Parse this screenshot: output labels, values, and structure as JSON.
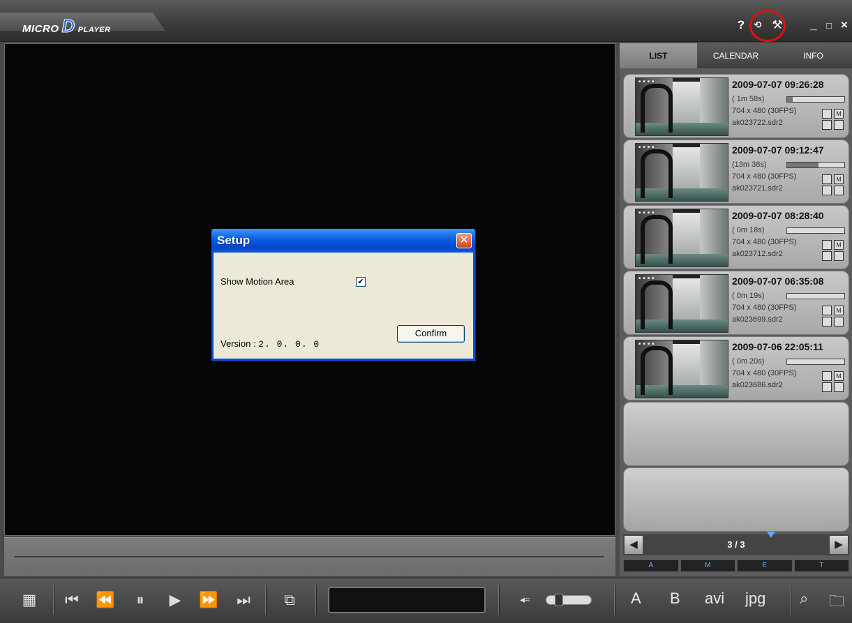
{
  "app": {
    "logo_micro": "MICRO",
    "logo_d": "D",
    "logo_player": "PLAYER",
    "title_icons": [
      "?",
      "⟲",
      "⚒",
      "_",
      "□",
      "×"
    ]
  },
  "dialog": {
    "title": "Setup",
    "close_glyph": "✕",
    "motion_label": "Show Motion Area",
    "motion_checked": true,
    "check_glyph": "✔",
    "version_label": "Version :",
    "version_value": "2. 0. 0. 0",
    "confirm_label": "Confirm"
  },
  "panel": {
    "tabs": [
      "LIST",
      "CALENDAR",
      "INFO"
    ],
    "active_tab": "LIST",
    "items": [
      {
        "date": "2009-07-07 09:26:28",
        "duration": "( 1m 58s)",
        "resolution": "704 x 480 (30FPS)",
        "file": "ak023722.sdr2",
        "progress": 0.1
      },
      {
        "date": "2009-07-07 09:12:47",
        "duration": "(13m 38s)",
        "resolution": "704 x 480 (30FPS)",
        "file": "ak023721.sdr2",
        "progress": 0.55
      },
      {
        "date": "2009-07-07 08:28:40",
        "duration": "( 0m 18s)",
        "resolution": "704 x 480 (30FPS)",
        "file": "ak023712.sdr2",
        "progress": 0.0
      },
      {
        "date": "2009-07-07 06:35:08",
        "duration": "( 0m 19s)",
        "resolution": "704 x 480 (30FPS)",
        "file": "ak023699.sdr2",
        "progress": 0.0
      },
      {
        "date": "2009-07-06 22:05:11",
        "duration": "( 0m 20s)",
        "resolution": "704 x 480 (30FPS)",
        "file": "ak023686.sdr2",
        "progress": 0.0
      }
    ],
    "m_label": "M",
    "page": "3 / 3",
    "ame_tabs": [
      "A",
      "M",
      "E",
      "T"
    ]
  },
  "controls": {
    "grid": "▦",
    "prev_track": "⏮",
    "rewind": "⏪",
    "pause": "⏸",
    "play": "▶",
    "fast_forward": "⏩",
    "next_track": "⏭",
    "snapshot": "⧉",
    "mute": "◂≈",
    "right_buttons": [
      "A",
      "B",
      "avi",
      "jpg",
      "⌕",
      "🗀"
    ]
  },
  "colors": {
    "accent_blue": "#0a5ce0",
    "highlight_red": "#e01010"
  }
}
